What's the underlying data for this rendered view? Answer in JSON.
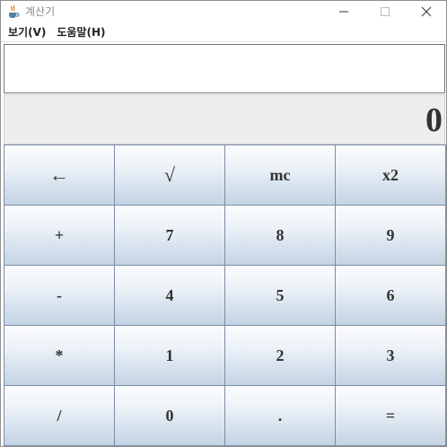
{
  "window": {
    "title": "계산기",
    "icon": "java-cup-icon",
    "controls": {
      "minimize_icon": "minimize-icon",
      "maximize_icon": "maximize-icon",
      "close_icon": "close-icon"
    }
  },
  "menubar": {
    "items": [
      {
        "label": "보기(V)"
      },
      {
        "label": "도움말(H)"
      }
    ]
  },
  "input": {
    "value": ""
  },
  "display": {
    "value": "0"
  },
  "keypad": {
    "rows": [
      [
        "←",
        "√",
        "mc",
        "x2"
      ],
      [
        "+",
        "7",
        "8",
        "9"
      ],
      [
        "-",
        "4",
        "5",
        "6"
      ],
      [
        "*",
        "1",
        "2",
        "3"
      ],
      [
        "/",
        "0",
        ".",
        "="
      ]
    ]
  },
  "colors": {
    "key_border": "#7c8da6",
    "key_gradient_top": "#fbfcfe",
    "key_gradient_bottom": "#c4d3e3",
    "display_bg": "#eeeeee",
    "display_text": "#333333"
  }
}
